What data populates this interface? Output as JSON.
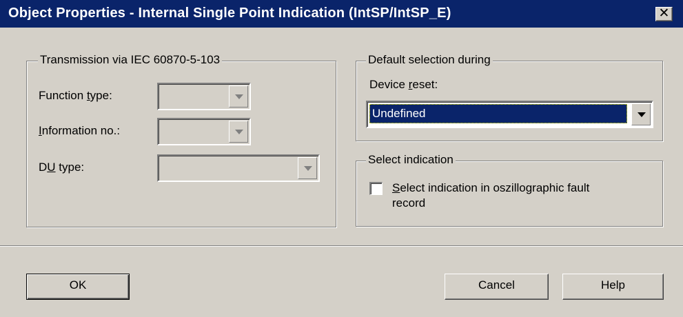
{
  "window": {
    "title": "Object Properties - Internal Single Point Indication (IntSP/IntSP_E)",
    "close_symbol": "✕"
  },
  "transmission": {
    "legend": "Transmission via IEC 60870-5-103",
    "function_type": {
      "label_pre": "Function ",
      "label_u": "t",
      "label_post": "ype:",
      "value": ""
    },
    "information_no": {
      "label_pre": "",
      "label_u": "I",
      "label_post": "nformation no.:",
      "value": ""
    },
    "du_type": {
      "label_pre": "D",
      "label_u": "U",
      "label_post": " type:",
      "value": ""
    }
  },
  "default_selection": {
    "legend": "Default selection during",
    "device_reset": {
      "label_pre": "Device ",
      "label_u": "r",
      "label_post": "eset:",
      "value": "Undefined"
    }
  },
  "select_indication": {
    "legend": "Select indication",
    "checkbox": {
      "checked": false,
      "label_u": "S",
      "label_line1": "elect indication in oszillographic fault",
      "label_line2": "record"
    }
  },
  "buttons": {
    "ok": "OK",
    "cancel": "Cancel",
    "help": "Help"
  },
  "colors": {
    "titlebar": "#0a246a",
    "face": "#d4d0c8",
    "selection": "#0a246a"
  }
}
